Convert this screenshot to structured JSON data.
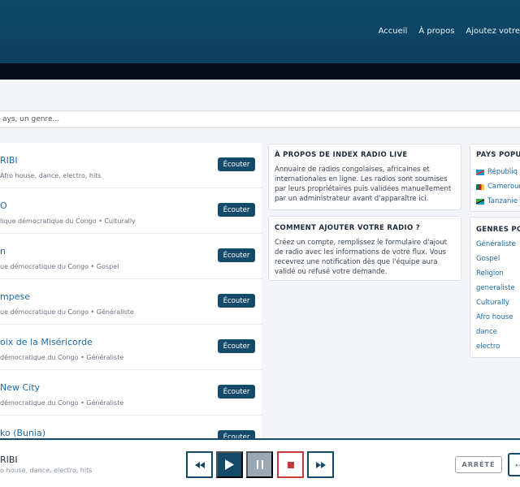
{
  "nav": {
    "items": [
      "Accueil",
      "À propos",
      "Ajoutez votre"
    ]
  },
  "search": {
    "placeholder": "ays, un genre..."
  },
  "stations": [
    {
      "name": "RIBI",
      "meta": "Afro house, dance, electro, hits",
      "button": "Écouter"
    },
    {
      "name": "O",
      "meta": "lique démocratique du Congo • Culturally",
      "button": "Écouter"
    },
    {
      "name": "n",
      "meta": "ue démocratique du Congo • Gospel",
      "button": "Écouter"
    },
    {
      "name": "mpese",
      "meta": "ue démocratique du Congo • Généraliste",
      "button": "Écouter"
    },
    {
      "name": "oix de la Miséricorde",
      "meta": "démocratique du Congo • Généraliste",
      "button": "Écouter"
    },
    {
      "name": "New City",
      "meta": "démocratique du Congo • Généraliste",
      "button": "Écouter"
    },
    {
      "name": "ko (Bunia)",
      "meta": "",
      "button": "Écouter"
    }
  ],
  "about": {
    "title": "À PROPOS DE INDEX RADIO LIVE",
    "text": "Annuaire de radios congolaises, africaines et internationales en ligne. Les radios sont soumises par leurs propriétaires puis validées manuellement par un administrateur avant d'apparaître ici."
  },
  "howto": {
    "title": "COMMENT AJOUTER VOTRE RADIO ?",
    "text": "Créez un compte, remplissez le formulaire d'ajout de radio avec les informations de votre flux. Vous recevrez une notification dès que l'équipe aura validé ou refusé votre demande."
  },
  "countries": {
    "title": "PAYS POPUL",
    "items": [
      {
        "label": "Républiq",
        "flag": "cd"
      },
      {
        "label": "Cameroun",
        "flag": "cm"
      },
      {
        "label": "Tanzanie",
        "flag": "tz"
      }
    ]
  },
  "genres": {
    "title": "GENRES PO",
    "items": [
      "Généraliste",
      "Gospel",
      "Religion",
      "generaliste",
      "Culturally",
      "Afro house",
      "dance",
      "electro"
    ]
  },
  "player": {
    "name": "RIBI",
    "meta": "o house, dance, electro, hits",
    "status": "ARRÊTÉ"
  },
  "colors": {
    "primary": "#154a6a",
    "link": "#1d6aa8",
    "stop": "#c63a3a"
  }
}
